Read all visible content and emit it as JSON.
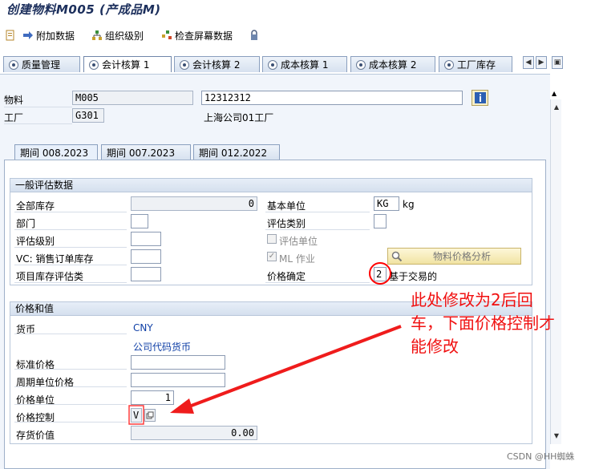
{
  "window": {
    "title": "创建物料M005 (产成品M)"
  },
  "toolbar": {
    "additional_data": "附加数据",
    "org_levels": "组织级别",
    "check_screen": "检查屏幕数据"
  },
  "tabs": [
    "质量管理",
    "会计核算 1",
    "会计核算 2",
    "成本核算 1",
    "成本核算 2",
    "工厂库存"
  ],
  "header": {
    "material_label": "物料",
    "material_value": "M005",
    "material_desc": "12312312",
    "plant_label": "工厂",
    "plant_value": "G301",
    "plant_desc": "上海公司01工厂"
  },
  "period_tabs": [
    "期间 008.2023",
    "期间 007.2023",
    "期间 012.2022"
  ],
  "general": {
    "title": "一般评估数据",
    "total_stock_label": "全部库存",
    "total_stock_value": "0",
    "base_unit_label": "基本单位",
    "base_unit_value": "KG",
    "base_unit_text": "kg",
    "division_label": "部门",
    "valuation_class_label": "评估类别",
    "valuation_level_label": "评估级别",
    "valuated_unit_label": "评估单位",
    "vc_label": "VC: 销售订单库存",
    "ml_label": "ML 作业",
    "project_label": "项目库存评估类",
    "price_determination_label": "价格确定",
    "price_determination_value": "2",
    "price_determination_text": "基于交易的",
    "analyze_button": "物料价格分析"
  },
  "prices": {
    "title": "价格和值",
    "currency_label": "货币",
    "currency_value": "CNY",
    "company_currency": "公司代码货币",
    "standard_price_label": "标准价格",
    "periodic_price_label": "周期单位价格",
    "price_unit_label": "价格单位",
    "price_unit_value": "1",
    "price_control_label": "价格控制",
    "price_control_value": "V",
    "stock_value_label": "存货价值",
    "stock_value_value": "0.00"
  },
  "annotation": {
    "line1": "此处修改为2后回",
    "line2": "车，下面价格控制才",
    "line3": "能修改"
  },
  "watermark": "CSDN @HH蜘蛛",
  "colors": {
    "annotation": "#f01010",
    "tab_border": "#8a9fbe",
    "panel_bg": "#f1f5fb"
  }
}
